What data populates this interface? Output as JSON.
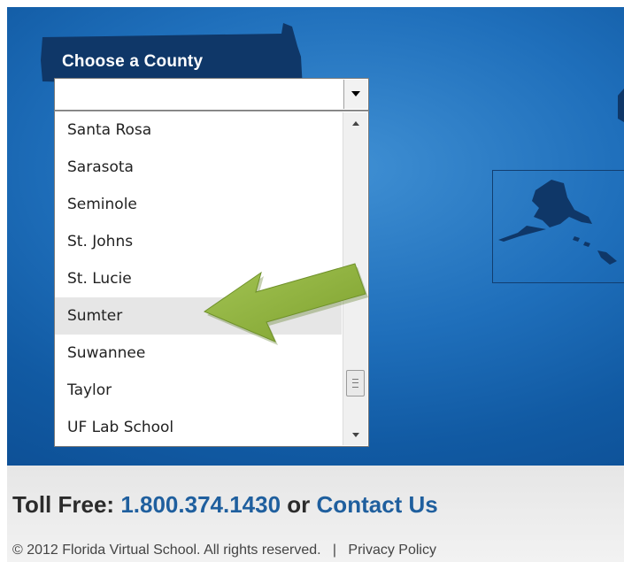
{
  "select": {
    "label": "Choose a County",
    "value": "",
    "options": [
      "Santa Rosa",
      "Sarasota",
      "Seminole",
      "St. Johns",
      "St. Lucie",
      "Sumter",
      "Suwannee",
      "Taylor",
      "UF Lab School"
    ],
    "highlighted": "Sumter"
  },
  "footer": {
    "toll_free_prefix": "Toll Free:",
    "phone": "1.800.374.1430",
    "or_text": "or",
    "contact": "Contact Us",
    "copyright": "© 2012 Florida Virtual School. All rights reserved.",
    "separator": "|",
    "privacy": "Privacy Policy"
  },
  "colors": {
    "hero": "#1f6fbb",
    "map_shape": "#0f3768",
    "link": "#1f5f9e",
    "arrow": "#8db33a"
  },
  "icons": [
    "dropdown-arrow-icon",
    "scroll-up-icon",
    "scroll-down-icon",
    "scroll-grip-icon",
    "annotation-arrow"
  ]
}
